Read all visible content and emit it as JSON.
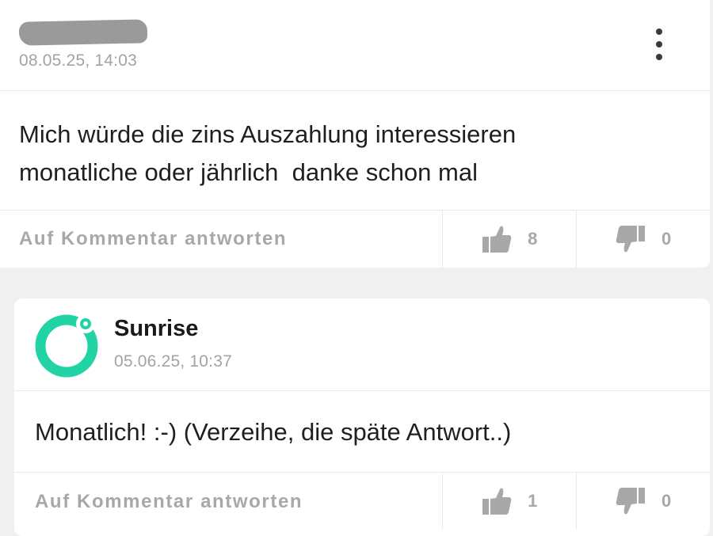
{
  "comments": [
    {
      "author": "",
      "timestamp": "08.05.25, 14:03",
      "text_lines": [
        "Mich würde die zins Auszahlung interessieren",
        "monatliche oder jährlich  danke schon mal"
      ],
      "reply_label": "Auf Kommentar antworten",
      "likes": "8",
      "dislikes": "0"
    },
    {
      "author": "Sunrise",
      "timestamp": "05.06.25, 10:37",
      "text_lines": [
        "Monatlich! :-) (Verzeihe, die späte Antwort..)"
      ],
      "reply_label": "Auf Kommentar antworten",
      "likes": "1",
      "dislikes": "0"
    }
  ],
  "icons": {
    "menu": "more-vertical-icon",
    "like": "thumbs-up-icon",
    "dislike": "thumbs-down-icon",
    "avatar": "sunrise-logo-icon"
  },
  "colors": {
    "brand_teal": "#22d3a6",
    "muted_text": "#a8a8a8",
    "body_text": "#1f1f1f"
  }
}
